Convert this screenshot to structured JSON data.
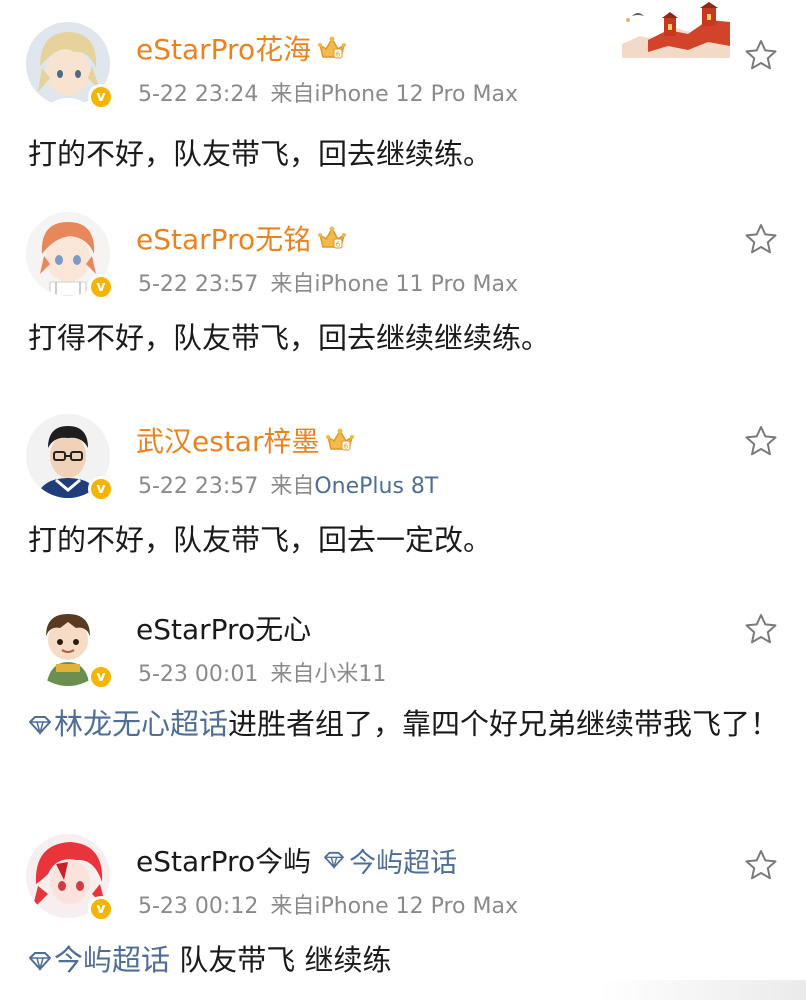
{
  "colors": {
    "vip_name": "#e8831f",
    "link": "#4e6e96",
    "meta": "#8a8a8a",
    "text": "#1a1a1a",
    "verified_badge": "#f4b400"
  },
  "posts": [
    {
      "username": "eStarPro花海",
      "vip": true,
      "date": "5-22 23:24",
      "source_label": "来自",
      "device": "iPhone 12 Pro Max",
      "content": "打的不好，队友带飞，回去继续练。",
      "avatar_icon": "avatar-blonde-boy-icon"
    },
    {
      "username": "eStarPro无铭",
      "vip": true,
      "date": "5-22 23:57",
      "source_label": "来自",
      "device": "iPhone 11 Pro Max",
      "content": "打得不好，队友带飞，回去继续继续练。",
      "avatar_icon": "avatar-orange-hair-icon"
    },
    {
      "username": "武汉estar梓墨",
      "vip": true,
      "date": "5-22 23:57",
      "source_label": "来自",
      "device": "OnePlus 8T",
      "content": "打的不好，队友带飞，回去一定改。",
      "avatar_icon": "avatar-boy-glasses-icon"
    },
    {
      "username": "eStarPro无心",
      "vip": false,
      "date": "5-23 00:01",
      "source_label": "来自",
      "device": "小米11",
      "content_topic": "林龙无心超话",
      "content": "进胜者组了，靠四个好兄弟继续带我飞了！",
      "avatar_icon": "avatar-cartoon-boy-icon"
    },
    {
      "username": "eStarPro今屿",
      "vip": false,
      "name_topic": "今屿超话",
      "date": "5-23 00:12",
      "source_label": "来自",
      "device": "iPhone 12 Pro Max",
      "content_topic": "今屿超话",
      "content": " 队友带飞 继续练",
      "avatar_icon": "avatar-red-hair-icon"
    }
  ]
}
